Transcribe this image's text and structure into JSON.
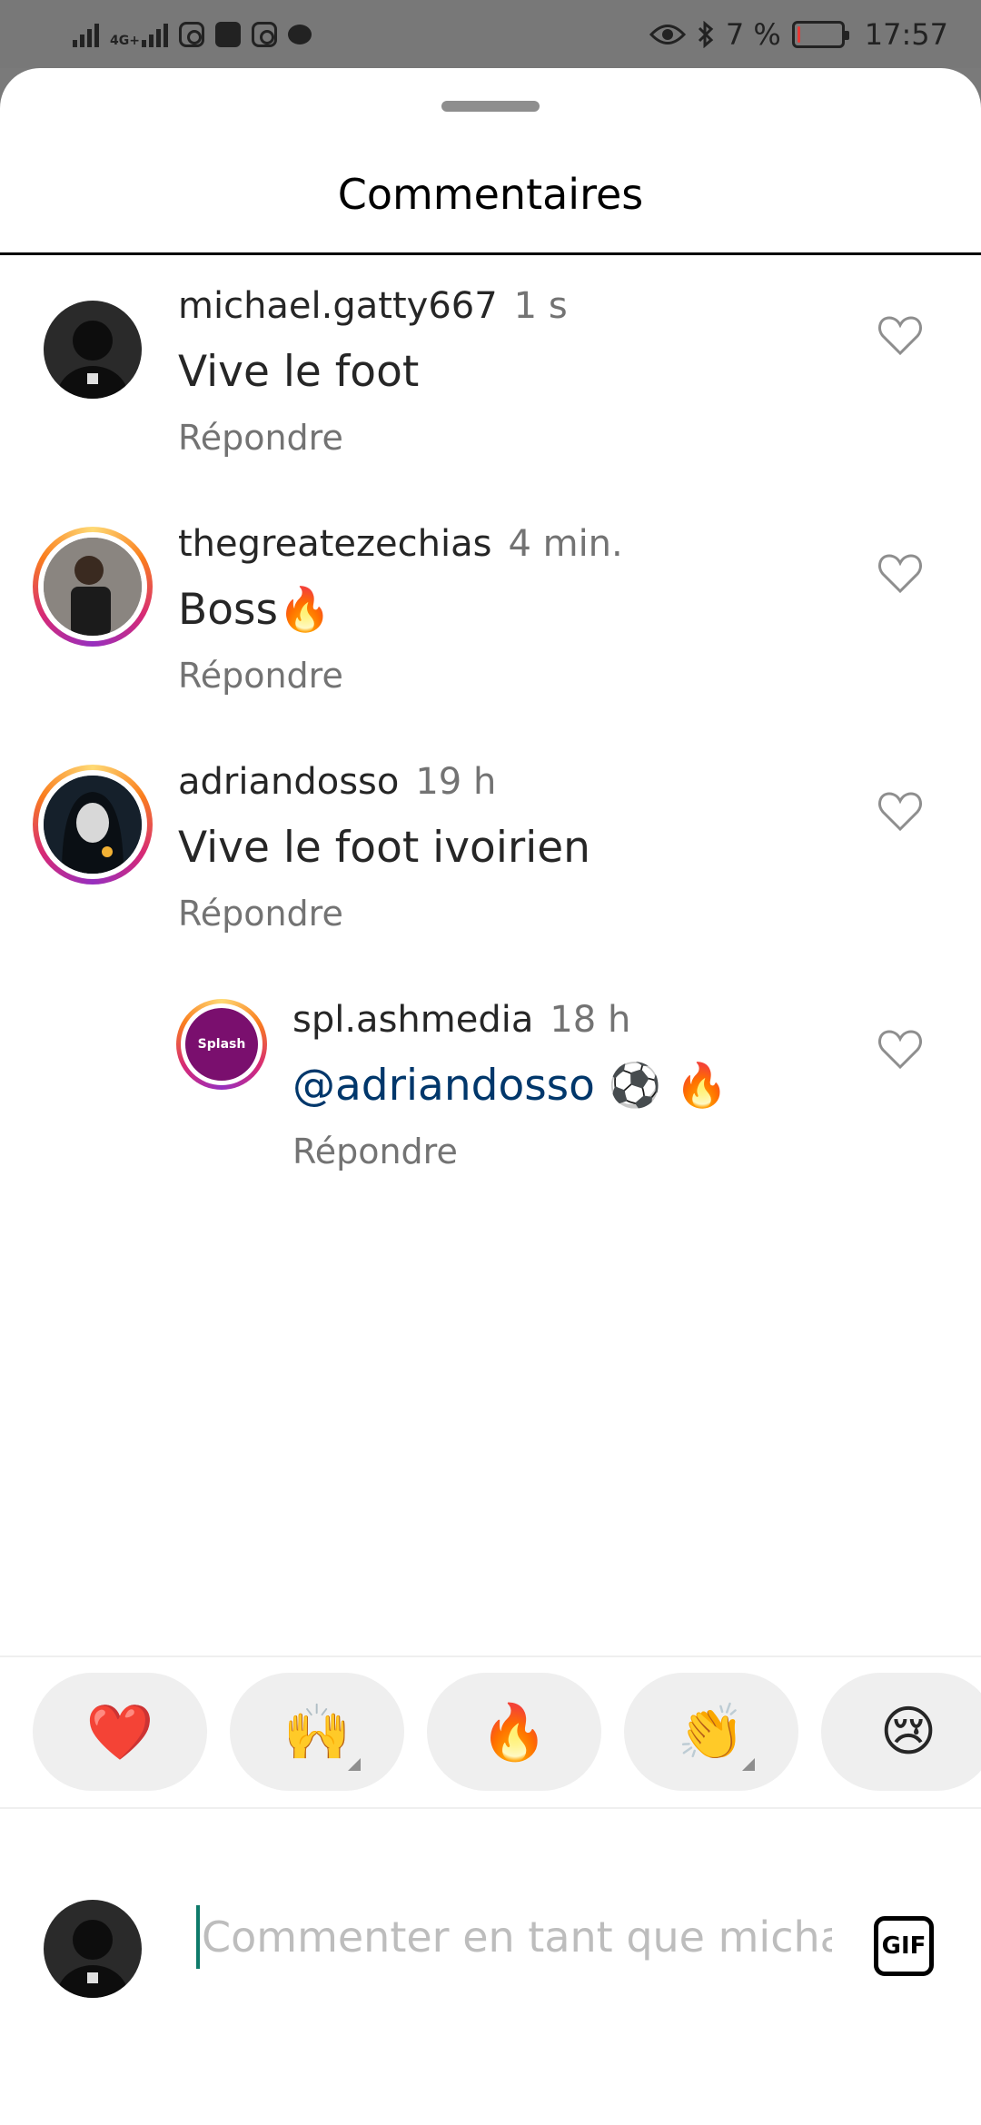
{
  "status_bar": {
    "network": "4G+",
    "battery_text": "7 %",
    "battery_level": 0.07,
    "time": "17:57"
  },
  "sheet": {
    "title": "Commentaires"
  },
  "comments": [
    {
      "username": "michael.gatty667",
      "time": "1 s",
      "text": "Vive le foot",
      "reply_label": "Répondre",
      "has_story_ring": false,
      "avatar_color": "#2a2a2a"
    },
    {
      "username": "thegreatezechias",
      "time": "4 min.",
      "text": "Boss🔥",
      "reply_label": "Répondre",
      "has_story_ring": true,
      "avatar_color": "#5a5a5a"
    },
    {
      "username": "adriandosso",
      "time": "19 h",
      "text": "Vive le foot ivoirien",
      "reply_label": "Répondre",
      "has_story_ring": true,
      "avatar_color": "#1d2b3a"
    },
    {
      "username": "spl.ashmedia",
      "time": "18 h",
      "mention": "@adriandosso",
      "text": " ⚽ 🔥",
      "reply_label": "Répondre",
      "has_story_ring": true,
      "avatar_text": "Splash",
      "avatar_color": "#7a0f6e",
      "is_reply": true
    }
  ],
  "reactions": [
    {
      "emoji": "❤️",
      "name": "heart",
      "has_variants": false
    },
    {
      "emoji": "🙌",
      "name": "raising-hands",
      "has_variants": true
    },
    {
      "emoji": "🔥",
      "name": "fire",
      "has_variants": false
    },
    {
      "emoji": "👏",
      "name": "clapping-hands",
      "has_variants": true
    },
    {
      "emoji": "😢",
      "name": "crying-face",
      "has_variants": false
    }
  ],
  "composer": {
    "placeholder": "Commenter en tant que michae",
    "gif_label": "GIF"
  },
  "colors": {
    "mention": "#00376b",
    "secondary_text": "#737373",
    "caret": "#0e7a6a"
  }
}
